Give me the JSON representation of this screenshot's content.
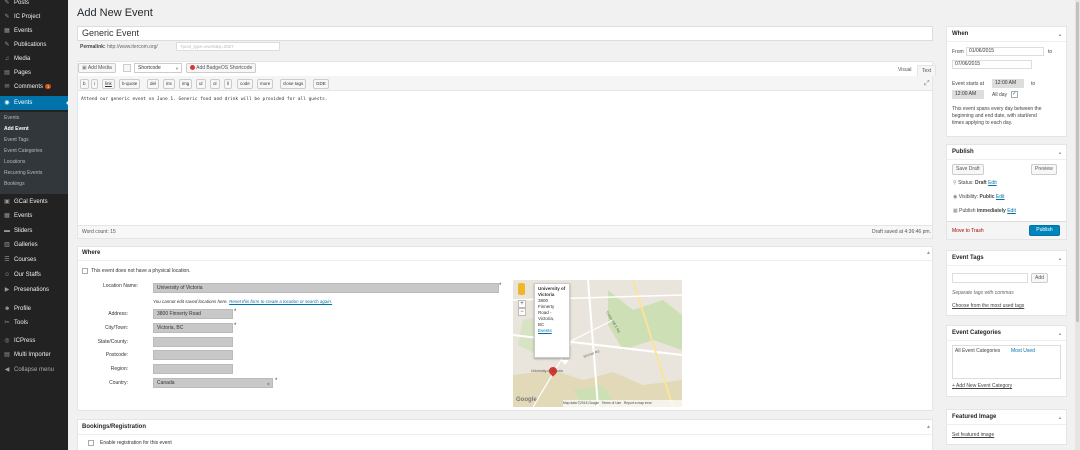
{
  "sidebar": {
    "items_top": [
      {
        "label": "Posts",
        "icon": "pin-icon",
        "glyph": "✎"
      },
      {
        "label": "IC Project",
        "icon": "pin-icon",
        "glyph": "✎"
      },
      {
        "label": "Events",
        "icon": "calendar-icon",
        "glyph": "▦"
      },
      {
        "label": "Publications",
        "icon": "pin-icon",
        "glyph": "✎"
      },
      {
        "label": "Media",
        "icon": "media-icon",
        "glyph": "♫"
      },
      {
        "label": "Pages",
        "icon": "pages-icon",
        "glyph": "▤"
      },
      {
        "label": "Comments",
        "icon": "comment-icon",
        "glyph": "✉",
        "badge": "1"
      },
      {
        "label": "Events",
        "icon": "events-icon",
        "glyph": "◉"
      }
    ],
    "submenu": [
      "Events",
      "Add Event",
      "Event Tags",
      "Event Categories",
      "Locations",
      "Recurring Events",
      "Bookings"
    ],
    "items_bottom": [
      {
        "label": "GCal Events",
        "icon": "gcal-icon",
        "glyph": "▣"
      },
      {
        "label": "Events",
        "icon": "calendar-icon",
        "glyph": "▦"
      },
      {
        "label": "Sliders",
        "icon": "slider-icon",
        "glyph": "▬"
      },
      {
        "label": "Galleries",
        "icon": "gallery-icon",
        "glyph": "▥"
      },
      {
        "label": "Courses",
        "icon": "courses-icon",
        "glyph": "☰"
      },
      {
        "label": "Our Staffs",
        "icon": "staff-icon",
        "glyph": "☺"
      },
      {
        "label": "Presenations",
        "icon": "presentation-icon",
        "glyph": "▶"
      },
      {
        "label": "Profile",
        "icon": "user-icon",
        "glyph": "☻"
      },
      {
        "label": "Tools",
        "icon": "wrench-icon",
        "glyph": "✂"
      },
      {
        "label": "ICPress",
        "icon": "icpress-icon",
        "glyph": "◎"
      },
      {
        "label": "Multi Importer",
        "icon": "importer-icon",
        "glyph": "▤"
      },
      {
        "label": "Collapse menu",
        "icon": "collapse-icon",
        "glyph": "◀"
      }
    ]
  },
  "page": {
    "title": "Add New Event"
  },
  "editor": {
    "title_value": "Generic Event",
    "permalink_label": "Permalink:",
    "permalink_url": "http://www.itercom.org/",
    "slug_placeholder": "?post_type=event&p=2927",
    "add_media": "Add Media",
    "shortcode_select": "Shortcode",
    "add_badge": "Add BadgeOS Shortcode",
    "tab_visual": "Visual",
    "tab_text": "Text",
    "quicktags": [
      "b",
      "i",
      "link",
      "b-quote",
      "del",
      "ins",
      "img",
      "ul",
      "ol",
      "li",
      "code",
      "more",
      "close tags",
      "GDE"
    ],
    "content": "Attend our generic event on June 1. Generic food and drink will be provided for all guests.",
    "word_count": "Word count: 15",
    "draft_saved": "Draft saved at 4:36:46 pm."
  },
  "where": {
    "title": "Where",
    "no_location": "This event does not have a physical location.",
    "location_name_label": "Location Name:",
    "location_name_value": "University of Victoria",
    "note_prefix": "You cannot edit saved locations here.",
    "note_link": "Reset this form to create a location or search again.",
    "address_label": "Address:",
    "address_value": "3800 Finnerty Road",
    "city_label": "City/Town:",
    "city_value": "Victoria, BC",
    "state_label": "State/County:",
    "postcode_label": "Postcode:",
    "region_label": "Region:",
    "country_label": "Country:",
    "country_value": "Canada",
    "required": "*",
    "map": {
      "popup_title": "University of Victoria",
      "popup_lines": [
        "3800",
        "Finnerty",
        "Road -",
        "Victoria,",
        "BC"
      ],
      "popup_link": "Events",
      "map_label": "University of Victoria",
      "street1": "Cedar Hill X Rd",
      "street2": "Sinclair Rd",
      "google": "Google",
      "map_data": "Map data ©2015 Google",
      "terms": "Terms of Use",
      "report": "Report a map error"
    }
  },
  "bookings": {
    "title": "Bookings/Registration",
    "enable": "Enable registration for this event"
  },
  "when": {
    "title": "When",
    "from_label": "From",
    "from_value": "01/06/2015",
    "to_label": "to",
    "to_value": "07/06/2015",
    "starts_label": "Event starts at",
    "start_time": "12:00 AM",
    "end_time": "12:00 AM",
    "all_day": "All day",
    "desc": [
      "This event spans every day between the",
      "beginning and end date, with start/end",
      "times applying to each day."
    ]
  },
  "publish": {
    "title": "Publish",
    "save_draft": "Save Draft",
    "preview": "Preview",
    "status_label": "Status:",
    "status_value": "Draft",
    "visibility_label": "Visibility:",
    "visibility_value": "Public",
    "publish_label": "Publish",
    "publish_value": "immediately",
    "edit": "Edit",
    "trash": "Move to Trash",
    "publish_button": "Publish"
  },
  "event_tags": {
    "title": "Event Tags",
    "add": "Add",
    "hint": "Separate tags with commas",
    "choose": "Choose from the most used tags"
  },
  "event_categories": {
    "title": "Event Categories",
    "tab_all": "All Event Categories",
    "tab_most": "Most Used",
    "add_new": "+ Add New Event Category"
  },
  "featured_image": {
    "title": "Featured Image",
    "set": "Set featured image"
  },
  "colors": {
    "accent": "#0073aa",
    "sidebar": "#222222",
    "publish": "#0085ba",
    "trash": "#a00000",
    "pin": "#dd3333"
  }
}
